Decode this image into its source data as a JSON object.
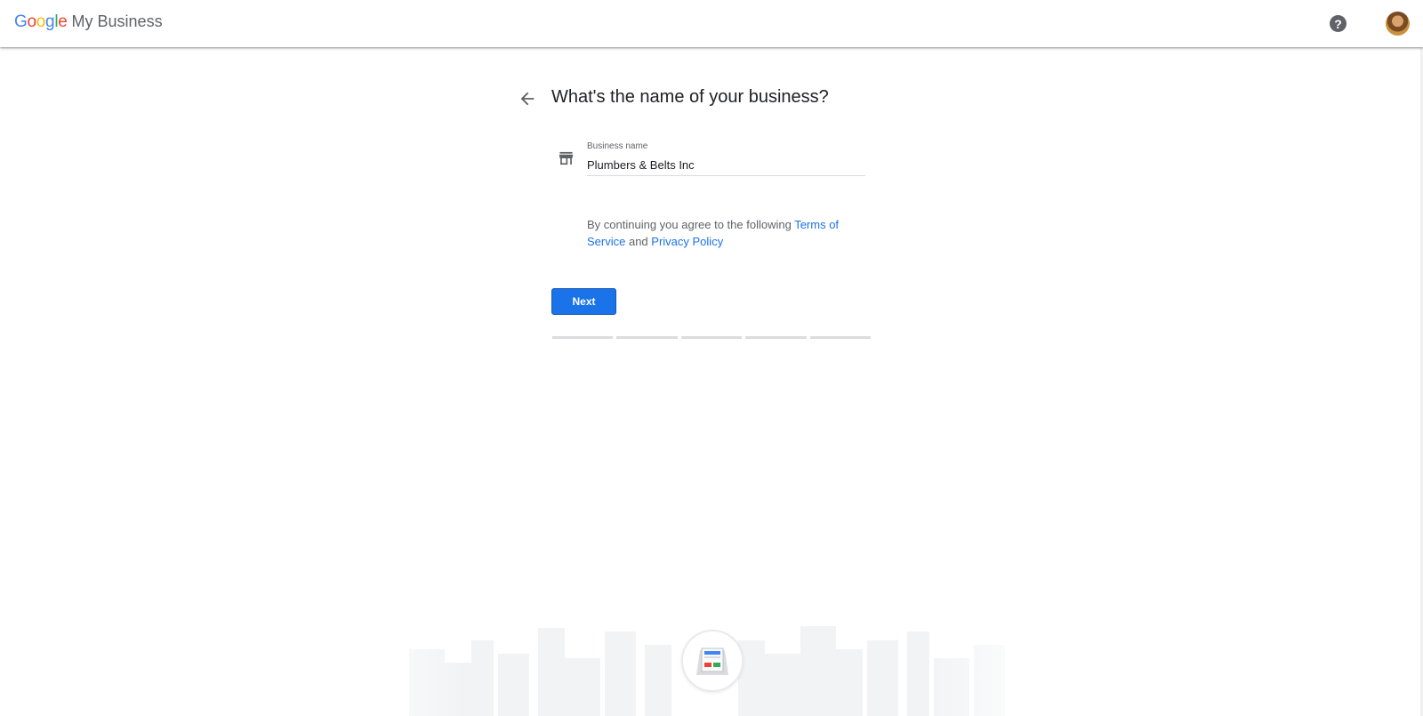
{
  "header": {
    "logo_google": [
      "G",
      "o",
      "o",
      "g",
      "l",
      "e"
    ],
    "logo_colors": [
      "#4285F4",
      "#EA4335",
      "#FBBC05",
      "#4285F4",
      "#34A853",
      "#EA4335"
    ],
    "product_name": "My Business",
    "help_icon": "help-circle-icon",
    "help_glyph": "?",
    "avatar": "user-avatar"
  },
  "main": {
    "back_icon": "arrow-back-icon",
    "title": "What's the name of your business?",
    "field": {
      "icon": "storefront-icon",
      "label": "Business name",
      "value": "Plumbers & Belts Inc"
    },
    "terms": {
      "prefix": "By continuing you agree to the following ",
      "tos_link": "Terms of Service",
      "middle": " and ",
      "privacy_link": "Privacy Policy"
    },
    "next_button": "Next",
    "progress": {
      "steps": 5,
      "current": 0
    }
  },
  "colors": {
    "accent": "#1a73e8",
    "text_primary": "#202124",
    "text_secondary": "#5f6368",
    "divider": "#dadce0"
  },
  "footer": {
    "illustration": "city-skyline-illustration",
    "badge_icon": "storefront-sign-icon"
  }
}
